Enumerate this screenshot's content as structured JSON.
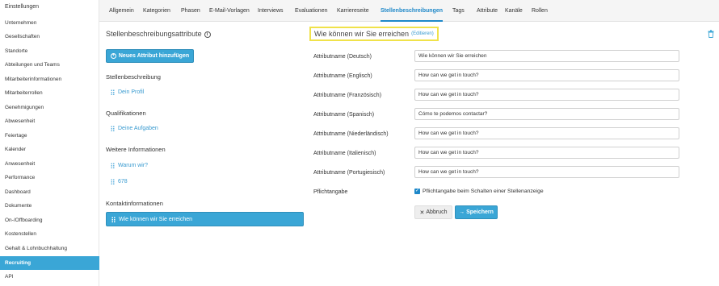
{
  "sidebar": {
    "title": "Einstellungen",
    "items": [
      {
        "label": "Unternehmen"
      },
      {
        "label": "Gesellschaften"
      },
      {
        "label": "Standorte"
      },
      {
        "label": "Abteilungen und Teams"
      },
      {
        "label": "Mitarbeiterinformationen"
      },
      {
        "label": "Mitarbeiterrollen"
      },
      {
        "label": "Genehmigungen"
      },
      {
        "label": "Abwesenheit"
      },
      {
        "label": "Feiertage"
      },
      {
        "label": "Kalender"
      },
      {
        "label": "Anwesenheit"
      },
      {
        "label": "Performance"
      },
      {
        "label": "Dashboard"
      },
      {
        "label": "Dokumente"
      },
      {
        "label": "On-/Offboarding"
      },
      {
        "label": "Kostenstellen"
      },
      {
        "label": "Gehalt & Lohnbuchhaltung"
      },
      {
        "label": "Recruiting",
        "active": true
      },
      {
        "label": "API"
      }
    ]
  },
  "tabs": [
    {
      "label": "Allgemein"
    },
    {
      "label": "Kategorien"
    },
    {
      "label": "Phasen"
    },
    {
      "label": "E-Mail-Vorlagen"
    },
    {
      "label": "Interviews"
    },
    {
      "label": "Evaluationen"
    },
    {
      "label": "Karriereseite"
    },
    {
      "label": "Stellenbeschreibungen",
      "active": true
    },
    {
      "label": "Tags"
    },
    {
      "label": "Attribute"
    },
    {
      "label": "Kanäle"
    },
    {
      "label": "Rollen"
    }
  ],
  "left": {
    "title": "Stellenbeschreibungsattribute",
    "add_button": "Neues Attribut hinzufügen",
    "sections": [
      {
        "title": "Stellenbeschreibung",
        "items": [
          "Dein Profil"
        ]
      },
      {
        "title": "Qualifikationen",
        "items": [
          "Deine Aufgaben"
        ]
      },
      {
        "title": "Weitere Informationen",
        "items": [
          "Warum wir?",
          "678"
        ]
      },
      {
        "title": "Kontaktinformationen",
        "items": [
          "Wie können wir Sie erreichen"
        ]
      }
    ]
  },
  "right": {
    "title": "Wie können wir Sie erreichen",
    "edit_link": "Editieren",
    "fields": [
      {
        "label": "Attributname (Deutsch)",
        "value": "Wie können wir Sie erreichen"
      },
      {
        "label": "Attributname (Englisch)",
        "value": "How can we get in touch?"
      },
      {
        "label": "Attributname (Französisch)",
        "value": "How can we get in touch?"
      },
      {
        "label": "Attributname (Spanisch)",
        "value": "Cómo te podemos contactar?"
      },
      {
        "label": "Attributname (Niederländisch)",
        "value": "How can we get in touch?"
      },
      {
        "label": "Attributname (Italienisch)",
        "value": "How can we get in touch?"
      },
      {
        "label": "Attributname (Portugiesisch)",
        "value": "How can we get in touch?"
      }
    ],
    "required_label": "Pflichtangabe",
    "required_checkbox_label": "Pflichtangabe beim Schalten einer Stellenanzeige",
    "required_checked": true,
    "cancel_label": "Abbruch",
    "save_label": "Speichern"
  }
}
